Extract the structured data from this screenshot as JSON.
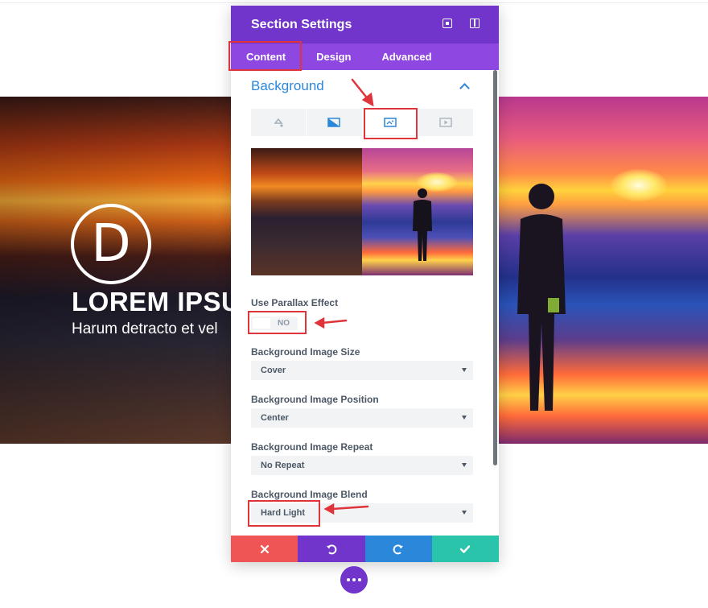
{
  "hero": {
    "logo_letter": "D",
    "title": "LOREM IPSUM",
    "subtitle": "Harum detracto et vel"
  },
  "modal": {
    "title": "Section Settings",
    "header_icons": [
      "fullscreen-icon",
      "sidebar-panel-icon"
    ],
    "tabs": [
      {
        "label": "Content",
        "active": true
      },
      {
        "label": "Design",
        "active": false
      },
      {
        "label": "Advanced",
        "active": false
      }
    ],
    "section_toggle": "Background",
    "bg_type_tabs": [
      "color-icon",
      "gradient-icon",
      "image-icon",
      "video-icon"
    ],
    "active_bg_type": "image-icon",
    "fields": {
      "parallax_label": "Use Parallax Effect",
      "parallax_value": "NO",
      "size_label": "Background Image Size",
      "size_value": "Cover",
      "position_label": "Background Image Position",
      "position_value": "Center",
      "repeat_label": "Background Image Repeat",
      "repeat_value": "No Repeat",
      "blend_label": "Background Image Blend",
      "blend_value": "Hard Light"
    },
    "footer": [
      {
        "icon": "close-icon",
        "color": "#ef5555"
      },
      {
        "icon": "undo-icon",
        "color": "#7135cb"
      },
      {
        "icon": "redo-icon",
        "color": "#2b87da"
      },
      {
        "icon": "check-icon",
        "color": "#29c4a9"
      }
    ]
  },
  "colors": {
    "primary_purple": "#7135cb",
    "tab_bar": "#8e47e0",
    "accent_blue": "#2b87da",
    "annotation_red": "#e0343b"
  }
}
